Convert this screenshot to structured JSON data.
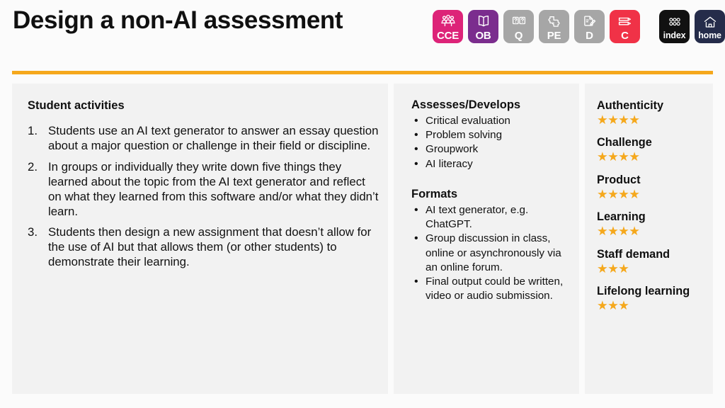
{
  "header": {
    "title": "Design a non-AI assessment",
    "accent_rule_color": "#F5A81C",
    "nav_buttons": [
      {
        "label": "CCE",
        "icon": "people-group-icon",
        "color": "#DD2378"
      },
      {
        "label": "OB",
        "icon": "open-book-icon",
        "color": "#7B2D8E"
      },
      {
        "label": "Q",
        "icon": "question-cards-icon",
        "color": "#A6A6A6"
      },
      {
        "label": "PE",
        "icon": "puzzle-pieces-icon",
        "color": "#A6A6A6"
      },
      {
        "label": "D",
        "icon": "document-pencil-icon",
        "color": "#A6A6A6"
      },
      {
        "label": "C",
        "icon": "pencils-icon",
        "color": "#F03247"
      },
      {
        "label": "index",
        "icon": "grid-circles-icon",
        "color": "#111111"
      },
      {
        "label": "home",
        "icon": "house-icon",
        "color": "#252C4A"
      }
    ]
  },
  "activities": {
    "heading": "Student activities",
    "items": [
      {
        "num": "1.",
        "text": "Students use an AI text generator to answer an essay question about a major question or challenge in their field or discipline."
      },
      {
        "num": "2.",
        "text": "In groups or individually they write down five things they learned about the topic from the AI text generator and reflect on what they learned from this software and/or what they didn’t learn."
      },
      {
        "num": "3.",
        "text": "Students then design a new assignment that doesn’t allow for the use of AI but that allows them (or other students) to demonstrate their learning."
      }
    ]
  },
  "assesses": {
    "heading": "Assesses/Develops",
    "items": [
      "Critical evaluation",
      "Problem solving",
      "Groupwork",
      "AI literacy"
    ]
  },
  "formats": {
    "heading": "Formats",
    "items": [
      "AI text generator, e.g. ChatGPT.",
      "Group discussion in class, online or asynchronously via an online forum.",
      "Final output could be written, video or audio submission."
    ]
  },
  "ratings": {
    "star_color": "#F5A81C",
    "max_stars": 4,
    "items": [
      {
        "label": "Authenticity",
        "stars": 4,
        "stars_text": "★★★★"
      },
      {
        "label": "Challenge",
        "stars": 4,
        "stars_text": "★★★★"
      },
      {
        "label": "Product",
        "stars": 4,
        "stars_text": "★★★★"
      },
      {
        "label": "Learning",
        "stars": 4,
        "stars_text": "★★★★"
      },
      {
        "label": "Staff demand",
        "stars": 3,
        "stars_text": "★★★"
      },
      {
        "label": "Lifelong learning",
        "stars": 3,
        "stars_text": "★★★"
      }
    ]
  }
}
